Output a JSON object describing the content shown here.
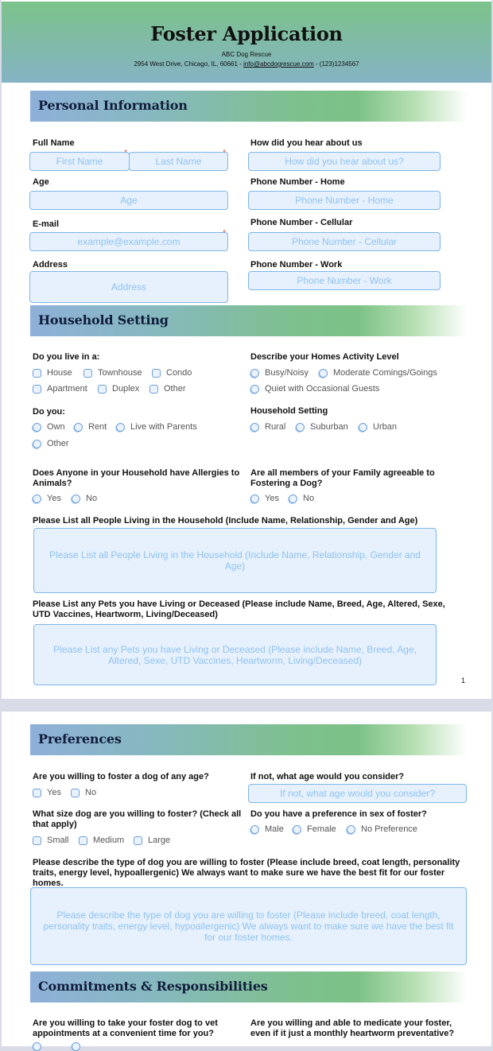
{
  "header": {
    "title": "Foster Application",
    "org": "ABC Dog Rescue",
    "address_prefix": "2954 West Drive, Chicago, IL, 60661 - ",
    "email": "info@abcdogrescue.com",
    "phone_suffix": " - (123)1234567"
  },
  "sections": {
    "personal": "Personal Information",
    "household": "Household Setting",
    "preferences": "Preferences",
    "commitments": "Commitments & Responsibilities"
  },
  "personal": {
    "full_name_label": "Full Name",
    "first_name_placeholder": "First Name",
    "last_name_placeholder": "Last Name",
    "age_label": "Age",
    "age_placeholder": "Age",
    "email_label": "E-mail",
    "email_placeholder": "example@example.com",
    "address_label": "Address",
    "address_placeholder": "Address",
    "hear_label": "How did you hear about us",
    "hear_placeholder": "How did you hear about us?",
    "phone_home_label": "Phone Number - Home",
    "phone_home_placeholder": "Phone Number - Home",
    "phone_cell_label": "Phone Number - Cellular",
    "phone_cell_placeholder": "Phone Number - Cellular",
    "phone_work_label": "Phone Number - Work",
    "phone_work_placeholder": "Phone Number - Work",
    "required_mark": "*"
  },
  "household": {
    "live_in_label": "Do you live in a:",
    "live_in_options": [
      "House",
      "Townhouse",
      "Condo",
      "Apartment",
      "Duplex",
      "Other"
    ],
    "do_you_label": "Do you:",
    "do_you_options": [
      "Own",
      "Rent",
      "Live with Parents",
      "Other"
    ],
    "activity_label": "Describe your Homes Activity Level",
    "activity_options": [
      "Busy/Noisy",
      "Moderate Comings/Goings",
      "Quiet with Occasional Guests"
    ],
    "setting_label": "Household Setting",
    "setting_options": [
      "Rural",
      "Suburban",
      "Urban"
    ],
    "allergies_label": "Does Anyone in your Household have Allergies to Animals?",
    "allergies_options": [
      "Yes",
      "No"
    ],
    "agreeable_label": "Are all members of your Family agreeable to Fostering a Dog?",
    "agreeable_options": [
      "Yes",
      "No"
    ],
    "people_label": "Please List all People Living in the Household (Include Name, Relationship, Gender and Age)",
    "people_placeholder": "Please List all People Living in the Household (Include Name, Relationship, Gender and Age)",
    "pets_label": "Please List any Pets you have Living or Deceased (Please include Name, Breed, Age, Altered, Sexe, UTD Vaccines, Heartworm, Living/Deceased)",
    "pets_placeholder": "Please List any Pets you have Living or Deceased (Please include Name, Breed, Age, Altered, Sexe, UTD Vaccines, Heartworm, Living/Deceased)"
  },
  "page_number": "1",
  "preferences": {
    "any_age_label": "Are you willing to foster a dog of any age?",
    "any_age_options": [
      "Yes",
      "No"
    ],
    "what_age_label": "If not, what age would you consider?",
    "what_age_placeholder": "If not, what age would you consider?",
    "size_label": "What size dog are you willing to foster? (Check all that apply)",
    "size_options": [
      "Small",
      "Medium",
      "Large"
    ],
    "sex_label": "Do you have a preference in sex of foster?",
    "sex_options": [
      "Male",
      "Female",
      "No Preference"
    ],
    "describe_label": "Please describe the type of dog you are willing to foster (Please include breed, coat length, personality traits, energy level, hypoallergenic) We always want to make sure we have the best fit for our foster homes.",
    "describe_placeholder": "Please describe the type of dog you are willing to foster (Please include breed, coat length, personality traits, energy level, hypoallergenic) We always want to make sure we have the best fit for our foster homes."
  },
  "commitments": {
    "vet_label": "Are you willing to take your foster dog to vet appointments at a convenient time for you?",
    "medicate_label": "Are you willing and able to medicate your foster, even if it just a monthly heartworm preventative?"
  }
}
